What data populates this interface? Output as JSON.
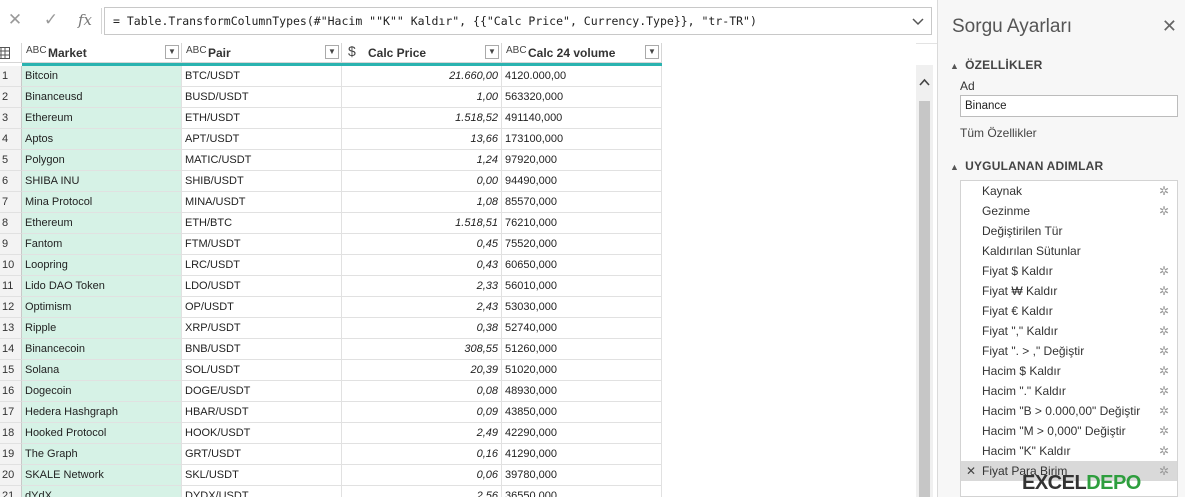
{
  "formula_bar": {
    "cancel_icon": "✕",
    "commit_icon": "✓",
    "fx_label": "fx",
    "formula": "= Table.TransformColumnTypes(#\"Hacim \"\"K\"\" Kaldır\", {{\"Calc Price\", Currency.Type}}, \"tr-TR\")"
  },
  "grid": {
    "columns": [
      {
        "type_icon": "ABC",
        "label": "Market"
      },
      {
        "type_icon": "ABC",
        "label": "Pair"
      },
      {
        "type_icon": "$",
        "label": "Calc Price"
      },
      {
        "type_icon": "ABC",
        "label": "Calc 24 volume"
      }
    ],
    "rows": [
      {
        "n": "1",
        "market": "Bitcoin",
        "pair": "BTC/USDT",
        "price": "21.660,00",
        "volume": "4120.000,00"
      },
      {
        "n": "2",
        "market": "Binanceusd",
        "pair": "BUSD/USDT",
        "price": "1,00",
        "volume": "563320,000"
      },
      {
        "n": "3",
        "market": "Ethereum",
        "pair": "ETH/USDT",
        "price": "1.518,52",
        "volume": "491140,000"
      },
      {
        "n": "4",
        "market": "Aptos",
        "pair": "APT/USDT",
        "price": "13,66",
        "volume": "173100,000"
      },
      {
        "n": "5",
        "market": "Polygon",
        "pair": "MATIC/USDT",
        "price": "1,24",
        "volume": "97920,000"
      },
      {
        "n": "6",
        "market": "SHIBA INU",
        "pair": "SHIB/USDT",
        "price": "0,00",
        "volume": "94490,000"
      },
      {
        "n": "7",
        "market": "Mina Protocol",
        "pair": "MINA/USDT",
        "price": "1,08",
        "volume": "85570,000"
      },
      {
        "n": "8",
        "market": "Ethereum",
        "pair": "ETH/BTC",
        "price": "1.518,51",
        "volume": "76210,000"
      },
      {
        "n": "9",
        "market": "Fantom",
        "pair": "FTM/USDT",
        "price": "0,45",
        "volume": "75520,000"
      },
      {
        "n": "10",
        "market": "Loopring",
        "pair": "LRC/USDT",
        "price": "0,43",
        "volume": "60650,000"
      },
      {
        "n": "11",
        "market": "Lido DAO Token",
        "pair": "LDO/USDT",
        "price": "2,33",
        "volume": "56010,000"
      },
      {
        "n": "12",
        "market": "Optimism",
        "pair": "OP/USDT",
        "price": "2,43",
        "volume": "53030,000"
      },
      {
        "n": "13",
        "market": "Ripple",
        "pair": "XRP/USDT",
        "price": "0,38",
        "volume": "52740,000"
      },
      {
        "n": "14",
        "market": "Binancecoin",
        "pair": "BNB/USDT",
        "price": "308,55",
        "volume": "51260,000"
      },
      {
        "n": "15",
        "market": "Solana",
        "pair": "SOL/USDT",
        "price": "20,39",
        "volume": "51020,000"
      },
      {
        "n": "16",
        "market": "Dogecoin",
        "pair": "DOGE/USDT",
        "price": "0,08",
        "volume": "48930,000"
      },
      {
        "n": "17",
        "market": "Hedera Hashgraph",
        "pair": "HBAR/USDT",
        "price": "0,09",
        "volume": "43850,000"
      },
      {
        "n": "18",
        "market": "Hooked Protocol",
        "pair": "HOOK/USDT",
        "price": "2,49",
        "volume": "42290,000"
      },
      {
        "n": "19",
        "market": "The Graph",
        "pair": "GRT/USDT",
        "price": "0,16",
        "volume": "41290,000"
      },
      {
        "n": "20",
        "market": "SKALE Network",
        "pair": "SKL/USDT",
        "price": "0,06",
        "volume": "39780,000"
      },
      {
        "n": "21",
        "market": "dYdX",
        "pair": "DYDX/USDT",
        "price": "2,56",
        "volume": "36550,000"
      }
    ]
  },
  "panel": {
    "title": "Sorgu Ayarları",
    "close_icon": "✕",
    "properties_header": "ÖZELLİKLER",
    "name_label": "Ad",
    "name_value": "Binance",
    "all_properties_link": "Tüm Özellikler",
    "steps_header": "UYGULANAN ADIMLAR",
    "steps": [
      {
        "label": "Kaynak",
        "gear": true,
        "selected": false
      },
      {
        "label": "Gezinme",
        "gear": true,
        "selected": false
      },
      {
        "label": "Değiştirilen Tür",
        "gear": false,
        "selected": false
      },
      {
        "label": "Kaldırılan Sütunlar",
        "gear": false,
        "selected": false
      },
      {
        "label": "Fiyat $ Kaldır",
        "gear": true,
        "selected": false
      },
      {
        "label": "Fiyat ₩ Kaldır",
        "gear": true,
        "selected": false
      },
      {
        "label": "Fiyat € Kaldır",
        "gear": true,
        "selected": false
      },
      {
        "label": "Fiyat \",\" Kaldır",
        "gear": true,
        "selected": false
      },
      {
        "label": "Fiyat \". > ,\" Değiştir",
        "gear": true,
        "selected": false
      },
      {
        "label": "Hacim $ Kaldır",
        "gear": true,
        "selected": false
      },
      {
        "label": "Hacim \".\" Kaldır",
        "gear": true,
        "selected": false
      },
      {
        "label": "Hacim \"B > 0.000,00\" Değiştir",
        "gear": true,
        "selected": false
      },
      {
        "label": "Hacim \"M > 0,000\" Değiştir",
        "gear": true,
        "selected": false
      },
      {
        "label": "Hacim \"K\" Kaldır",
        "gear": true,
        "selected": false
      },
      {
        "label": "Fiyat Para Birim",
        "gear": true,
        "selected": true
      }
    ]
  },
  "watermark": {
    "part1": "EXCEL",
    "part2": "DEPO"
  },
  "colors": {
    "market_column_bg": "#d6f2e6",
    "quality_bar": "#2ab3b0",
    "selected_step_bg": "#d9d9d9"
  }
}
